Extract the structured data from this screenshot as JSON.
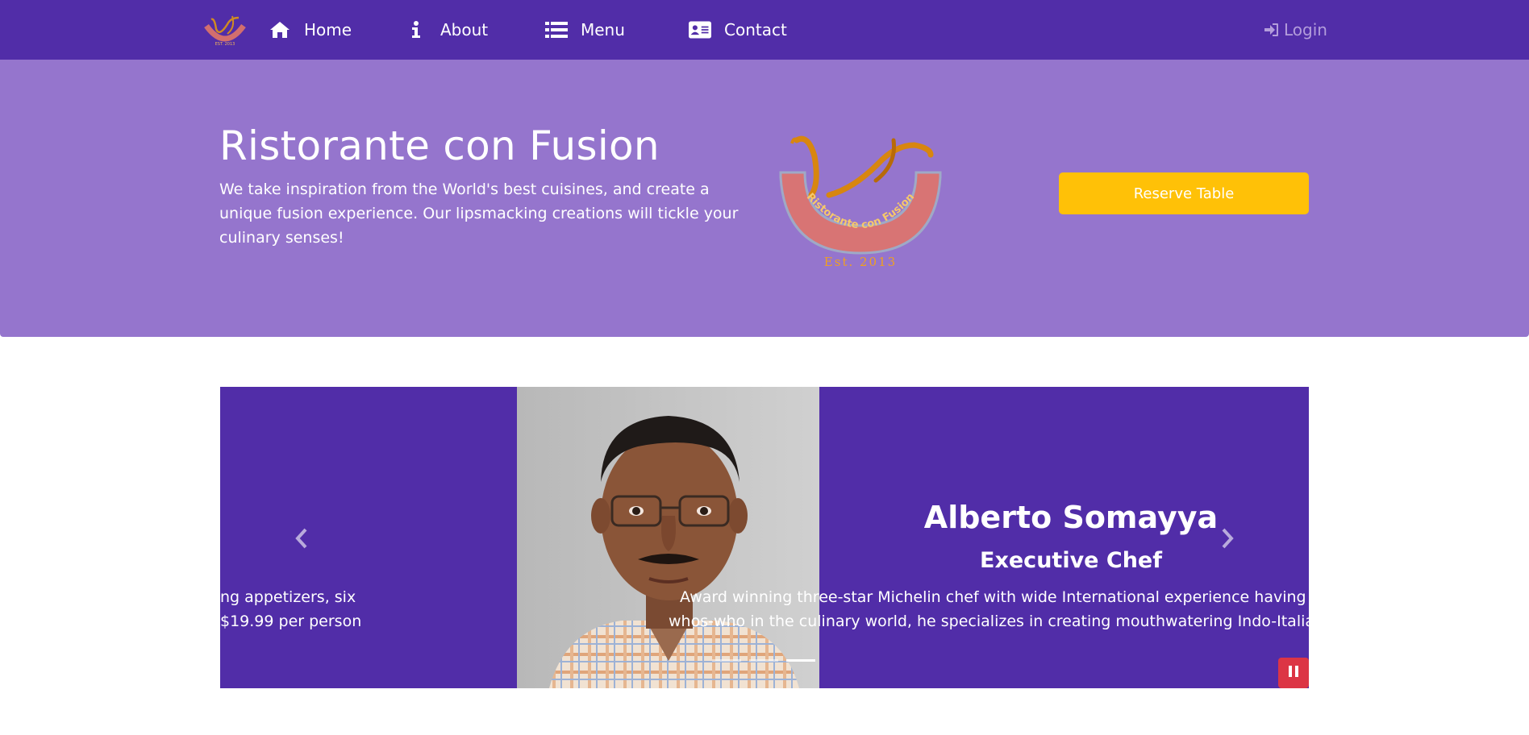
{
  "navbar": {
    "logo_alt": "Ristorante con Fusion",
    "items": [
      {
        "label": "Home",
        "icon": "home-icon"
      },
      {
        "label": "About",
        "icon": "info-icon"
      },
      {
        "label": "Menu",
        "icon": "list-icon"
      },
      {
        "label": "Contact",
        "icon": "address-card-icon"
      }
    ],
    "login": {
      "label": "Login",
      "icon": "sign-in-icon"
    }
  },
  "jumbotron": {
    "title": "Ristorante con Fusion",
    "description": "We take inspiration from the World's best cuisines, and create a unique fusion experience. Our lipsmacking creations will tickle your culinary senses!",
    "logo_text": "Ristorante con Fusion",
    "logo_est": "Est. 2013",
    "reserve_label": "Reserve Table"
  },
  "carousel": {
    "previous_slide_text": {
      "line1": "ng appetizers, six",
      "line2": "$19.99 per person"
    },
    "active_slide": {
      "name": "Alberto Somayya",
      "role": "Executive Chef",
      "description_line1": "Award winning three-star Michelin chef with wide International experience having wor",
      "description_line2": "whos-who in the culinary world, he specializes in creating mouthwatering Indo-Italian fu"
    },
    "indicators": [
      {
        "active": false
      },
      {
        "active": false
      },
      {
        "active": true
      }
    ],
    "pause_icon": "pause-icon",
    "prev_icon": "chevron-left-icon",
    "next_icon": "chevron-right-icon"
  },
  "colors": {
    "primary_dark": "#512da8",
    "primary_light": "#9575cd",
    "warning": "#ffc107",
    "danger": "#dc3545",
    "login_text": "#b39ddb"
  }
}
